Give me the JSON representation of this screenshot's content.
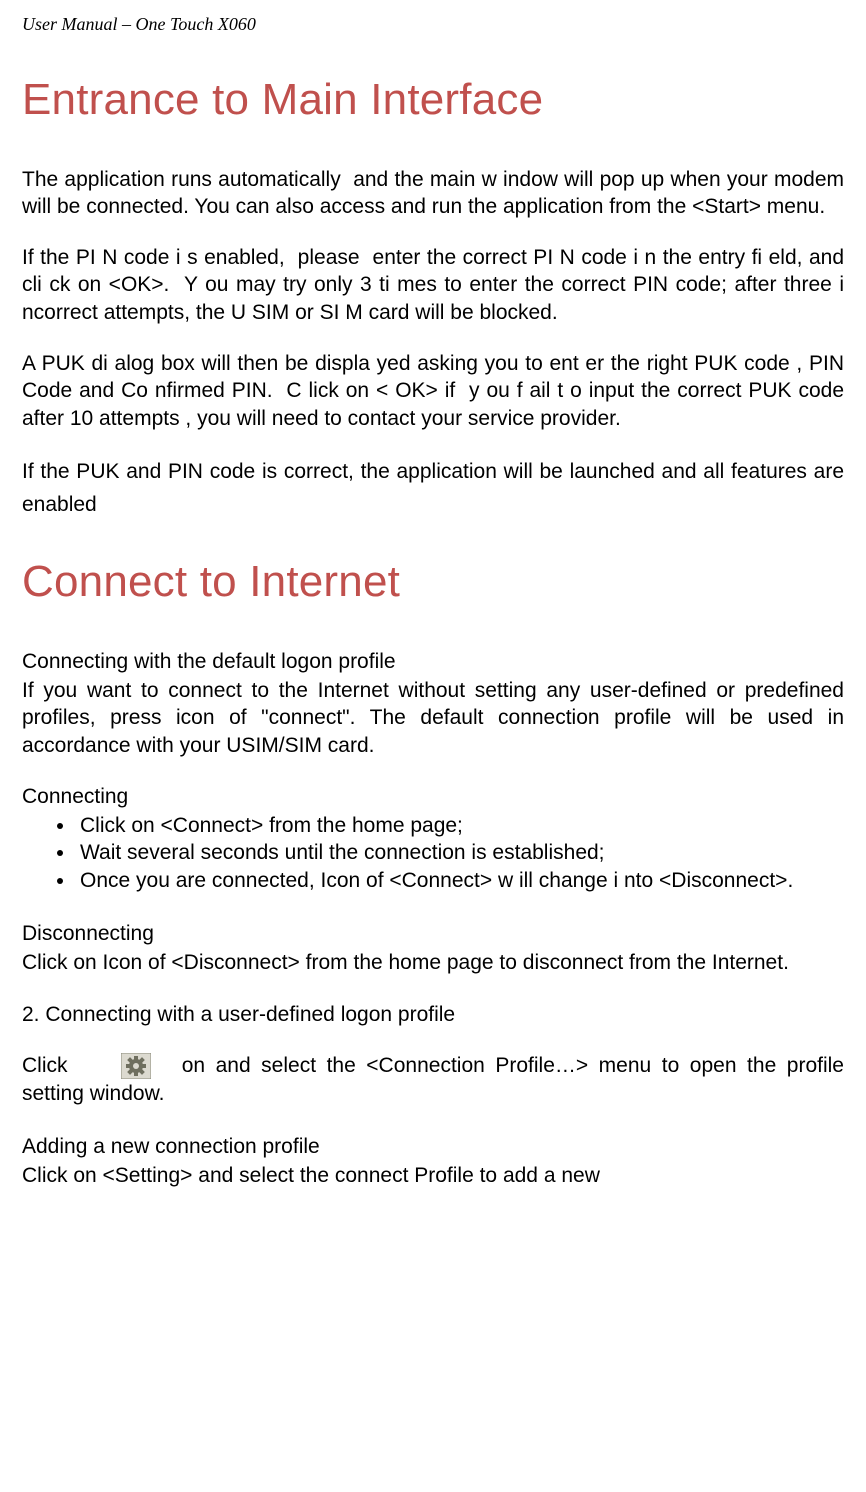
{
  "running_head": "User Manual – One Touch X060",
  "sections": {
    "entrance": {
      "title": "Entrance to Main Interface",
      "p1": "The application runs automatically  and the main w indow will pop up when your modem will be connected. You can also access and run the application from the <Start> menu.",
      "p2": "If the PI N code i s enabled,  please  enter the correct PI N code i n the entry fi eld, and cli ck on <OK>.  Y ou may try only 3 ti mes to enter the correct PIN code; after three i ncorrect attempts, the U SIM or SI M card will be blocked.",
      "p3": "A PUK di alog box will then be displa yed asking you to ent er the right PUK code , PIN  Code and Co nfirmed PIN.  C lick on < OK> if  y ou f ail t o input the correct PUK code after 10 attempts , you will need to contact your service provider.",
      "p4": "If the PUK and PIN code is correct, the application will be launched and all features are enabled"
    },
    "connect": {
      "title": "Connect to Internet",
      "sub1": "Connecting with the default logon profile",
      "p1": "If you want to connect to the Internet without setting any user-defined or predefined profiles, press icon of \"connect\". The default connection profile will be used in accordance with your USIM/SIM card.",
      "sub2": "Connecting",
      "bullets": [
        "Click on <Connect> from the home page;",
        "Wait several seconds until the connection is established;",
        "Once you are connected,  Icon of <Connect> w ill change i nto <Disconnect>."
      ],
      "sub3": "Disconnecting",
      "p2": "Click on Icon of <Disconnect> from the home page to disconnect from the Internet.",
      "sub4": "2. Connecting with a user-defined logon profile",
      "click_before": "Click",
      "click_after": "on and select the <Connection Profile…> menu to open the profile setting window.",
      "sub5": "Adding a new connection profile",
      "p3": "Click on <Setting> and select the connect Profile to add a new"
    }
  },
  "icons": {
    "settings_gear": "settings-gear-icon"
  }
}
